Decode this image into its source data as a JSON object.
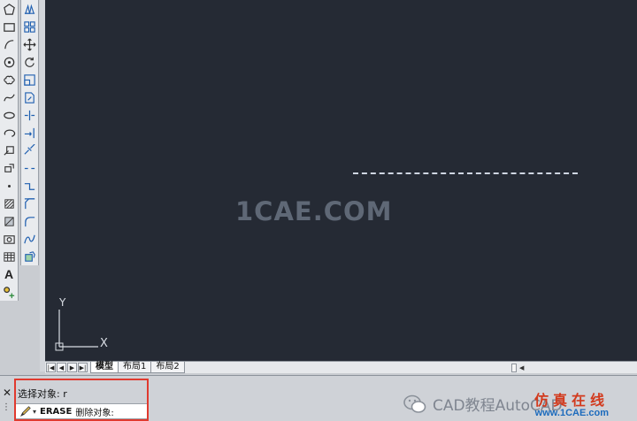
{
  "canvas": {
    "watermark": "1CAE.COM",
    "ucs": {
      "y_label": "Y",
      "x_label": "X"
    }
  },
  "toolbar_draw": {
    "icons": [
      "polygon-icon",
      "rectangle-icon",
      "arc-icon",
      "circle-icon",
      "revision-cloud-icon",
      "spline-icon",
      "ellipse-icon",
      "ellipse-arc-icon",
      "insert-block-icon",
      "make-block-icon",
      "point-icon",
      "hatch-icon",
      "gradient-icon",
      "region-icon",
      "table-icon",
      "multiline-text-icon",
      "add-selected-icon"
    ],
    "text_tool_label": "A"
  },
  "toolbar_modify": {
    "icons": [
      "mirror-icon",
      "array-icon",
      "move-icon",
      "rotate-icon",
      "scale-icon",
      "stretch-icon",
      "trim-icon",
      "extend-icon",
      "break-at-point-icon",
      "break-icon",
      "join-icon",
      "chamfer-icon",
      "fillet-icon",
      "blend-curves-icon",
      "explode-icon"
    ]
  },
  "layout_tabs": {
    "nav": [
      "|◀",
      "◀",
      "▶",
      "▶|"
    ],
    "tabs": [
      {
        "label": "模型",
        "active": true
      },
      {
        "label": "布局1",
        "active": false
      },
      {
        "label": "布局2",
        "active": false
      }
    ]
  },
  "command": {
    "history": "选择对象: r",
    "prompt_command": "ERASE",
    "prompt_text": "删除对象:",
    "close_glyph": "✕"
  },
  "watermark_footer": {
    "wechat_text": "CAD教程AutoCAD",
    "site_cn": "仿真在线",
    "site_url": "www.1CAE.com"
  },
  "colors": {
    "canvas_bg": "#252a34",
    "highlight_box": "#e03a2f",
    "site_cn": "#d23a1d",
    "site_url": "#1c6bbd"
  }
}
